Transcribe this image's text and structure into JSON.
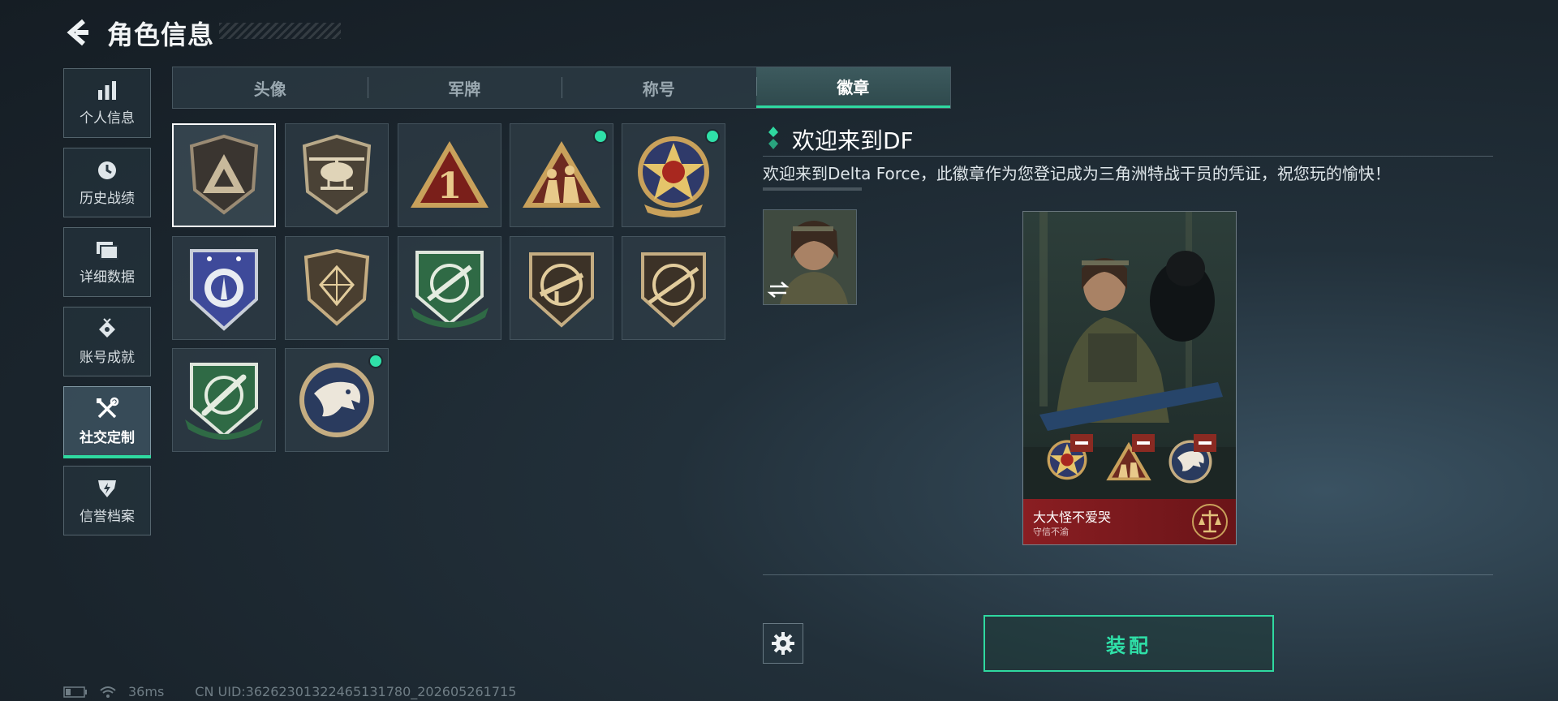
{
  "header": {
    "title": "角色信息",
    "back_icon": "chevron-left-icon"
  },
  "sidebar": {
    "items": [
      {
        "label": "个人信息",
        "icon": "bar-chart-icon"
      },
      {
        "label": "历史战绩",
        "icon": "clock-icon"
      },
      {
        "label": "详细数据",
        "icon": "folder-icon"
      },
      {
        "label": "账号成就",
        "icon": "achievement-icon"
      },
      {
        "label": "社交定制",
        "icon": "tools-icon",
        "active": true
      },
      {
        "label": "信誉档案",
        "icon": "shield-bolt-icon"
      }
    ]
  },
  "tabs": [
    {
      "label": "头像"
    },
    {
      "label": "军牌"
    },
    {
      "label": "称号"
    },
    {
      "label": "徽章",
      "active": true
    }
  ],
  "badges": [
    {
      "name": "delta-triangle-badge",
      "selected": true,
      "new": false
    },
    {
      "name": "helicopter-badge",
      "new": false
    },
    {
      "name": "number-one-badge",
      "new": false
    },
    {
      "name": "soldiers-triangle-badge",
      "new": true
    },
    {
      "name": "star-skull-badge",
      "new": true
    },
    {
      "name": "blue-shield-badge",
      "new": false
    },
    {
      "name": "diamond-shield-badge",
      "new": false
    },
    {
      "name": "green-rifle-badge",
      "new": false
    },
    {
      "name": "smg-badge",
      "new": false
    },
    {
      "name": "sniper-badge",
      "new": false
    },
    {
      "name": "green-knife-badge",
      "new": false
    },
    {
      "name": "eagle-badge",
      "new": true
    }
  ],
  "detail": {
    "title": "欢迎来到DF",
    "description": "欢迎来到Delta Force，此徽章作为您登记成为三角洲特战干员的凭证，祝您玩的愉快！",
    "swap_icon": "swap-icon"
  },
  "card": {
    "player_name": "大大怪不爱哭",
    "reputation": "守信不渝",
    "reputation_icon": "scales-icon",
    "remove_icon": "minus-icon"
  },
  "actions": {
    "equip_label": "装配",
    "settings_icon": "gear-icon"
  },
  "status_bar": {
    "ping": "36ms",
    "uid": "CN UID:3626230132246513178​0_202605261715"
  },
  "colors": {
    "accent": "#2fd9a0",
    "card_footer": "#8a1e22"
  }
}
